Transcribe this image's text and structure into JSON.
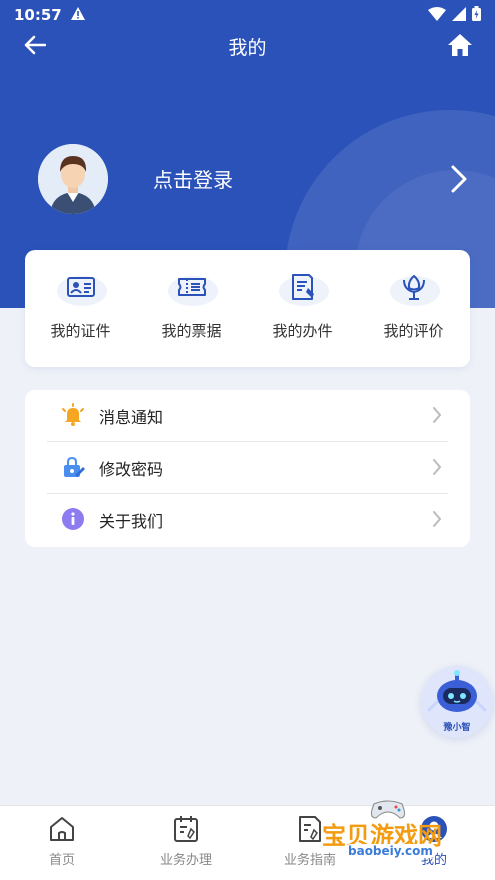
{
  "status_bar": {
    "time": "10:57"
  },
  "header": {
    "title": "我的"
  },
  "profile": {
    "login_text": "点击登录"
  },
  "quick_actions": [
    {
      "label": "我的证件",
      "icon": "id-card-icon"
    },
    {
      "label": "我的票据",
      "icon": "ticket-icon"
    },
    {
      "label": "我的办件",
      "icon": "document-edit-icon"
    },
    {
      "label": "我的评价",
      "icon": "flower-icon"
    }
  ],
  "menu": [
    {
      "label": "消息通知",
      "icon": "bell-icon",
      "color": "#f5a623"
    },
    {
      "label": "修改密码",
      "icon": "lock-edit-icon",
      "color": "#4a8ef0"
    },
    {
      "label": "关于我们",
      "icon": "info-icon",
      "color": "#8c7cf0"
    }
  ],
  "assistant": {
    "label": "豫小智"
  },
  "tabs": [
    {
      "label": "首页",
      "icon": "home-icon"
    },
    {
      "label": "业务办理",
      "icon": "calendar-edit-icon"
    },
    {
      "label": "业务指南",
      "icon": "guide-doc-icon"
    },
    {
      "label": "我的",
      "icon": "user-icon"
    }
  ],
  "watermark": {
    "text": "宝贝游戏网",
    "url": "baobeiy.com"
  },
  "colors": {
    "primary": "#2b52b8",
    "background": "#eef1f8"
  }
}
